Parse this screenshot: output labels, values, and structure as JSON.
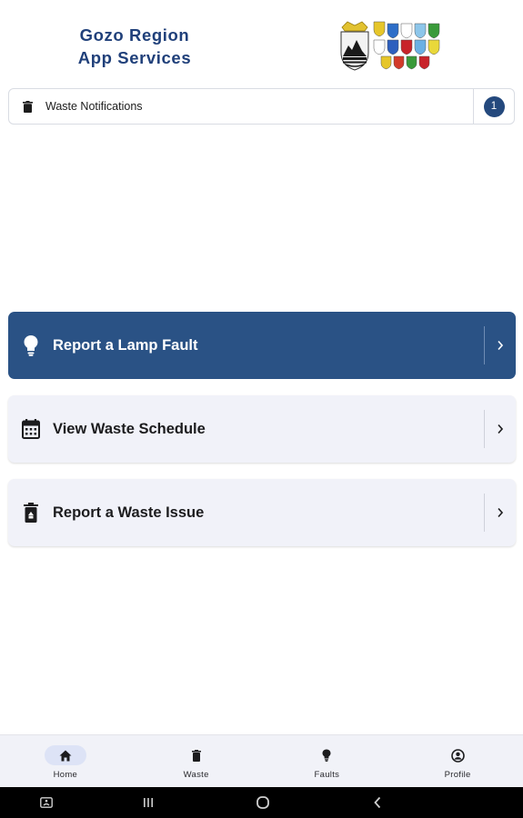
{
  "header": {
    "title_line1": "Gozo Region",
    "title_line2": "App Services",
    "logo_icon": "gozo-region-crest-logo"
  },
  "notifications": {
    "label": "Waste Notifications",
    "count": "1",
    "icon": "trash-icon"
  },
  "actions": [
    {
      "label": "Report a Lamp Fault",
      "icon": "lightbulb-icon",
      "style": "primary"
    },
    {
      "label": "View Waste Schedule",
      "icon": "calendar-icon",
      "style": "secondary"
    },
    {
      "label": "Report a Waste Issue",
      "icon": "recycle-bin-icon",
      "style": "secondary"
    }
  ],
  "bottom_nav": {
    "items": [
      {
        "label": "Home",
        "icon": "home-icon",
        "active": true
      },
      {
        "label": "Waste",
        "icon": "trash-icon",
        "active": false
      },
      {
        "label": "Faults",
        "icon": "lightbulb-icon",
        "active": false
      },
      {
        "label": "Profile",
        "icon": "account-circle-icon",
        "active": false
      }
    ]
  },
  "system_bar": {
    "buttons": [
      "accessibility-icon",
      "recent-apps-icon",
      "home-circle-icon",
      "back-icon"
    ]
  },
  "colors": {
    "primary": "#2a5285",
    "title": "#20407a",
    "card_bg": "#f1f2f9",
    "nav_bg": "#f1f2f8"
  }
}
